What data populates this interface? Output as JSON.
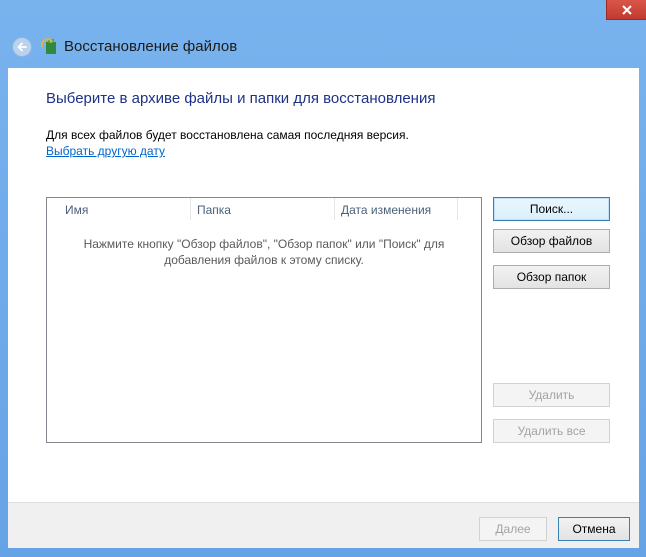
{
  "window": {
    "title": "Восстановление файлов"
  },
  "main": {
    "heading": "Выберите в архиве файлы и папки для восстановления",
    "info": "Для всех файлов будет восстановлена самая последняя версия.",
    "date_link": "Выбрать другую дату"
  },
  "filelist": {
    "columns": [
      "Имя",
      "Папка",
      "Дата изменения"
    ],
    "empty_line1": "Нажмите кнопку \"Обзор файлов\", \"Обзор папок\" или \"Поиск\" для",
    "empty_line2": "добавления файлов к этому списку."
  },
  "actions": {
    "search": "Поиск...",
    "browse_files": "Обзор файлов",
    "browse_folders": "Обзор папок",
    "remove": "Удалить",
    "remove_all": "Удалить все"
  },
  "footer": {
    "next": "Далее",
    "cancel": "Отмена"
  },
  "icons": {
    "close": "close-icon",
    "back": "back-arrow-icon",
    "app": "file-history-icon"
  },
  "colors": {
    "frame": "#6aa6e6",
    "close": "#c7463b",
    "heading": "#1e3287",
    "link": "#0066cc"
  }
}
